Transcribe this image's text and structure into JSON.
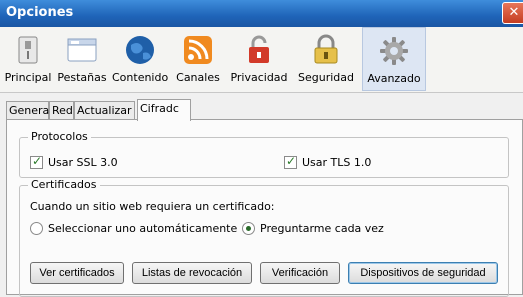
{
  "window": {
    "title": "Opciones",
    "close_glyph": "✕"
  },
  "toolbar": {
    "items": [
      {
        "label": "Principal",
        "icon": "switch-icon"
      },
      {
        "label": "Pestañas",
        "icon": "tabs-window-icon"
      },
      {
        "label": "Contenido",
        "icon": "globe-icon"
      },
      {
        "label": "Canales",
        "icon": "rss-feed-icon"
      },
      {
        "label": "Privacidad",
        "icon": "privacy-lock-icon"
      },
      {
        "label": "Seguridad",
        "icon": "padlock-icon"
      },
      {
        "label": "Avanzado",
        "icon": "gear-icon"
      }
    ],
    "selected": "Avanzado"
  },
  "tabs": [
    {
      "label": "General"
    },
    {
      "label": "Red"
    },
    {
      "label": "Actualizar"
    },
    {
      "label": "Cifradc"
    }
  ],
  "active_tab": "Cifradc",
  "protocols": {
    "title": "Protocolos",
    "ssl_label": "Usar SSL 3.0",
    "ssl_checked": true,
    "tls_label": "Usar TLS 1.0",
    "tls_checked": true
  },
  "certificates": {
    "title": "Certificados",
    "prompt": "Cuando un sitio web requiera un certificado:",
    "option_auto": "Seleccionar uno automáticamente",
    "option_ask": "Preguntarme cada vez",
    "selected_option": "Preguntarme cada vez",
    "buttons": {
      "view": "Ver certificados",
      "revocation": "Listas de revocación",
      "verification": "Verificación",
      "devices": "Dispositivos de seguridad"
    }
  }
}
